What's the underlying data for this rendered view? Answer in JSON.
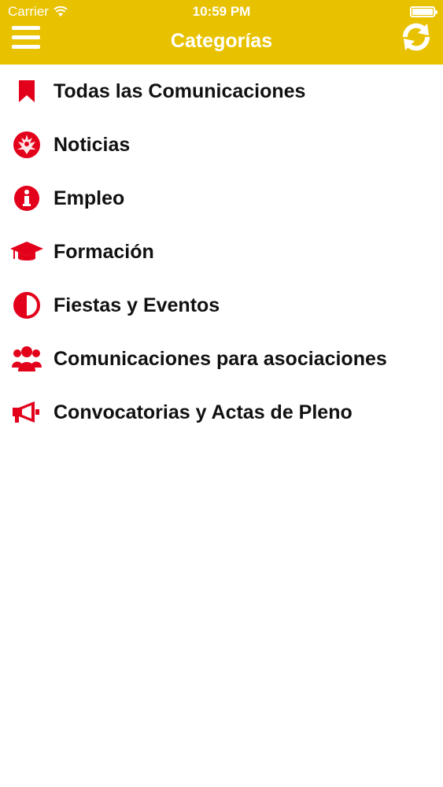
{
  "status_bar": {
    "carrier": "Carrier",
    "time": "10:59 PM"
  },
  "header": {
    "title": "Categorías",
    "menu_icon": "hamburger-menu-icon",
    "refresh_icon": "refresh-icon"
  },
  "colors": {
    "header_bg": "#e8c200",
    "icon_red": "#e3001b",
    "text": "#111111"
  },
  "categories": [
    {
      "label": "Todas las Comunicaciones",
      "icon": "bookmark-icon"
    },
    {
      "label": "Noticias",
      "icon": "rebel-emblem-icon"
    },
    {
      "label": "Empleo",
      "icon": "info-circle-icon"
    },
    {
      "label": "Formación",
      "icon": "graduation-cap-icon"
    },
    {
      "label": "Fiestas y Eventos",
      "icon": "half-circle-icon"
    },
    {
      "label": "Comunicaciones para asociaciones",
      "icon": "group-icon"
    },
    {
      "label": "Convocatorias y Actas de Pleno",
      "icon": "megaphone-icon"
    }
  ]
}
